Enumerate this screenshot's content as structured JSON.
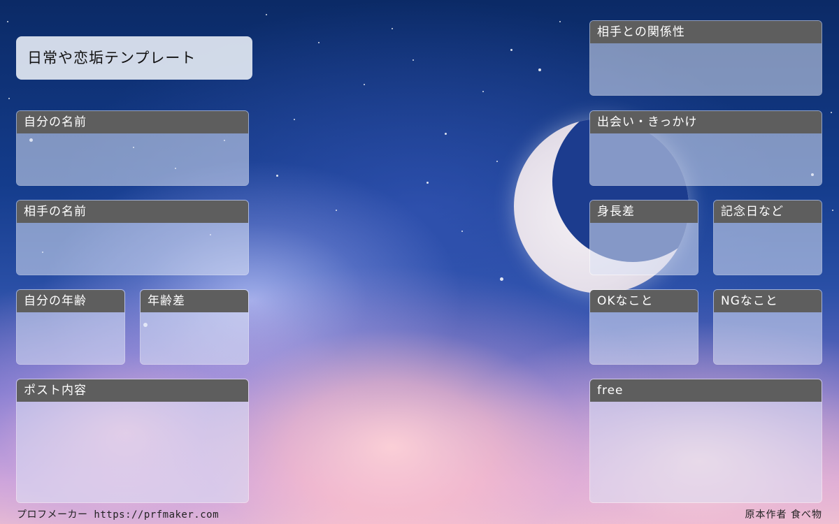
{
  "title": "日常や恋垢テンプレート",
  "fields": {
    "my_name": "自分の名前",
    "partner_name": "相手の名前",
    "my_age": "自分の年齢",
    "age_gap": "年齢差",
    "post_content": "ポスト内容",
    "relationship": "相手との関係性",
    "meeting": "出会い・きっかけ",
    "height_gap": "身長差",
    "anniversary": "記念日など",
    "ok_things": "OKなこと",
    "ng_things": "NGなこと",
    "free": "free"
  },
  "footer": {
    "left": "プロフメーカー https://prfmaker.com",
    "right": "原本作者 食べ物"
  }
}
